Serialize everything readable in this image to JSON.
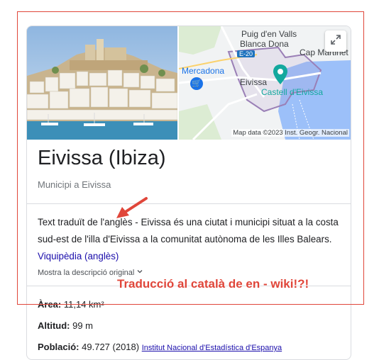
{
  "map": {
    "labels": [
      "Puig d'en Valls",
      "Blanca Dona",
      "E-20",
      "Cap Martinet",
      "Mercadona",
      "Eivissa",
      "Castell d'Eivissa"
    ],
    "credit": "Map data ©2023 Inst. Geogr. Nacional"
  },
  "entity": {
    "title": "Eivissa (Ibiza)",
    "subtitle": "Municipi a Eivissa"
  },
  "description": {
    "text": "Text traduït de l'anglès - Eivissa és una ciutat i municipi situat a la costa sud-est de l'illa d'Eivissa a la comunitat autònoma de les Illes Balears.",
    "link": "Viquipèdia (anglès)",
    "more": "Mostra la descripció original"
  },
  "facts": [
    {
      "label": "Àrea:",
      "value": "11,14 km²",
      "source": ""
    },
    {
      "label": "Altitud:",
      "value": "99 m",
      "source": ""
    },
    {
      "label": "Població:",
      "value": "49.727 (2018)",
      "source": "Institut Nacional d'Estadística d'Espanya"
    }
  ],
  "annotation": {
    "text": "Traducció al català de en - wiki!?!",
    "color": "#e0463a"
  },
  "colors": {
    "link": "#1a0dab",
    "annotation": "#e0463a",
    "map_water": "#9cc0f9",
    "map_poi_teal": "#13a89e"
  },
  "icons": [
    "expand-icon",
    "location-pin-icon",
    "shopping-cart-icon",
    "chevron-down-icon",
    "arrow-icon"
  ]
}
